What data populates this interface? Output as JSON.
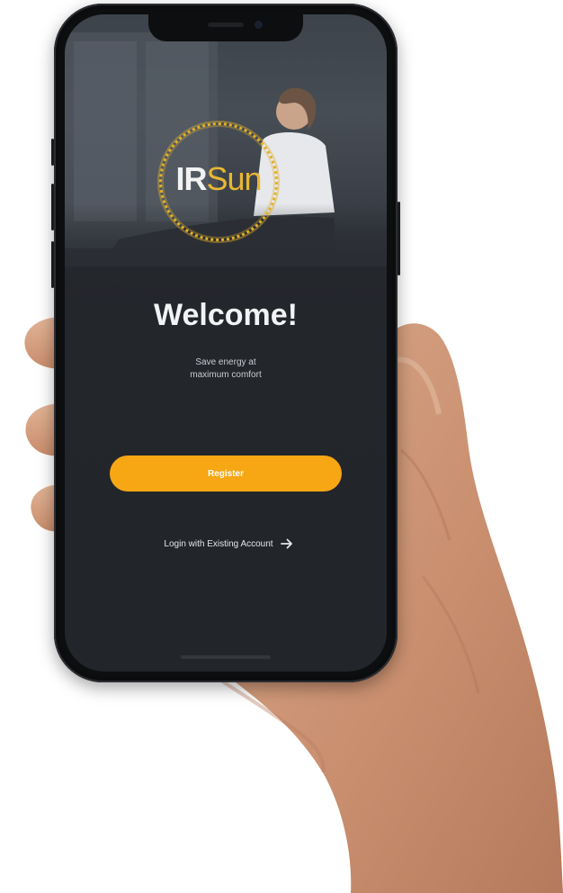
{
  "app": {
    "brand": {
      "logo_prefix": "IR",
      "logo_suffix": "Sun",
      "accent": "#e8b733"
    },
    "welcome": {
      "title": "Welcome!",
      "subtitle_line1": "Save energy at",
      "subtitle_line2": "maximum comfort"
    },
    "actions": {
      "register_label": "Register",
      "register_color": "#f7a614",
      "login_label": "Login with Existing Account",
      "login_icon": "arrow-right-icon"
    },
    "colors": {
      "screen_bg": "#23262b",
      "text": "#f2f3f5"
    }
  }
}
